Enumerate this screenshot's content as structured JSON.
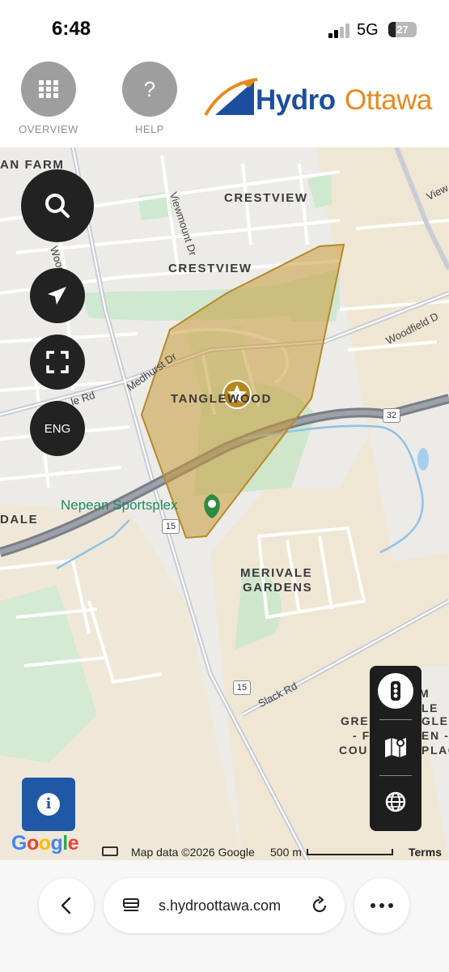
{
  "status": {
    "time": "6:48",
    "network": "5G",
    "battery": "27",
    "battery_level": 0.27
  },
  "header": {
    "overview_label": "OVERVIEW",
    "help_label": "HELP",
    "help_glyph": "?",
    "logo_part1": "Hydro",
    "logo_part2": "Ottawa",
    "colors": {
      "brand_blue": "#1c4ea0",
      "brand_orange": "#e78a1e"
    }
  },
  "map": {
    "area_labels": {
      "an_farm": "AN FARM",
      "crestview_1": "CRESTVIEW",
      "crestview_2": "CRESTVIEW",
      "tanglewood": "TANGLEWOOD",
      "dale": "DALE",
      "merivale": "MERIVALE",
      "gardens": "GARDENS"
    },
    "road_labels": {
      "viewmount": "Viewmount Dr",
      "woodroffe": "Woodroffe Ave",
      "medhurst": "Medhurst Dr",
      "woodfield": "Woodfield D",
      "le_rd": "le Rd",
      "slack": "Slack Rd",
      "view_edge": "View"
    },
    "place_label": "Nepean Sportsplex",
    "highway_shields": {
      "h32": "32",
      "h15a": "15",
      "h15b": "15"
    },
    "overlay_labels": [
      "M",
      "LE",
      "GRE",
      "GLE",
      "- F",
      "EN -",
      "COU",
      "PLAC"
    ],
    "controls": {
      "language": "ENG"
    },
    "attribution": {
      "data": "Map data ©2026 Google",
      "scale": "500 m",
      "terms": "Terms",
      "google": "Google"
    },
    "colors": {
      "outage_fill": "#c99a3a",
      "outage_stroke": "#b58a2a",
      "pin": "#2e8b3e"
    }
  },
  "browser": {
    "url": "s.hydroottawa.com"
  }
}
